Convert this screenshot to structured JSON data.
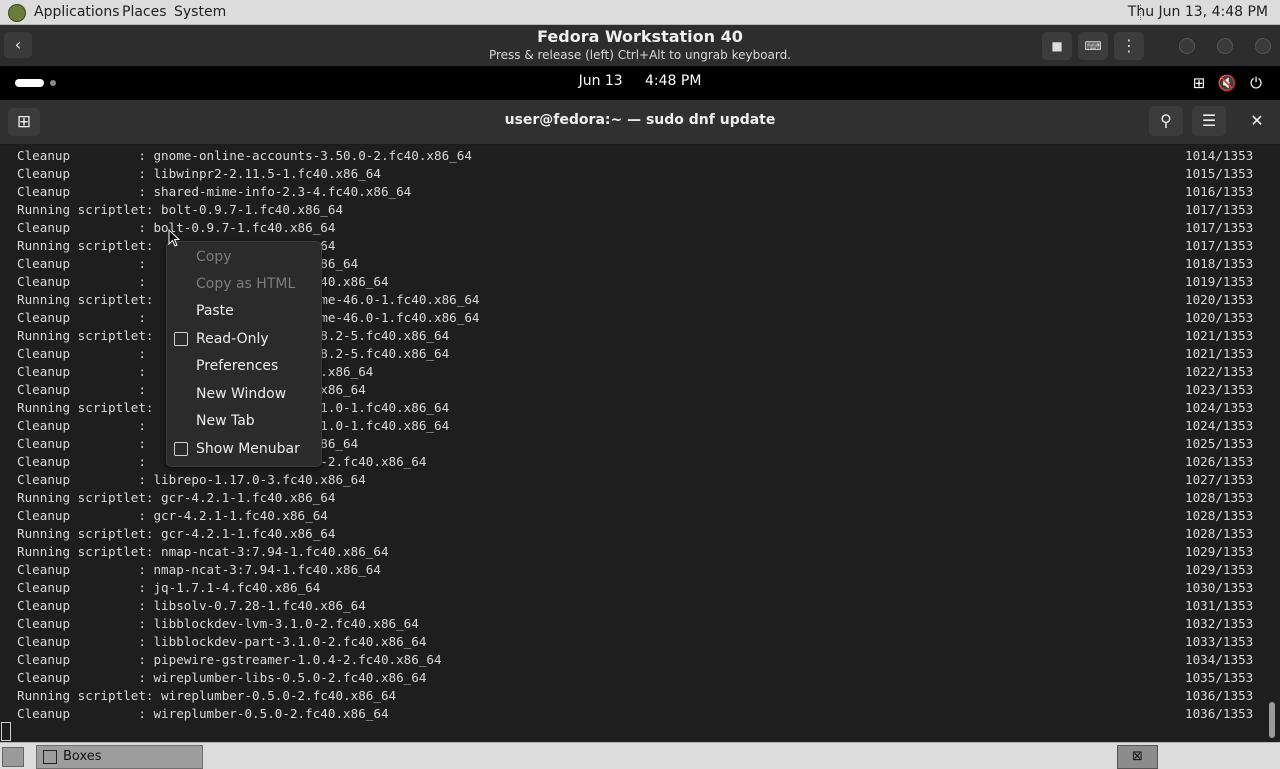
{
  "host_panel": {
    "menus": [
      "Applications",
      "Places",
      "System"
    ],
    "clock": "Thu Jun 13,  4:48 PM"
  },
  "boxes_header": {
    "title": "Fedora Workstation 40",
    "subtitle": "Press & release (left) Ctrl+Alt to ungrab keyboard.",
    "back_icon": "‹",
    "stop_icon": "■",
    "keyboard_icon": "⌨",
    "menu_icon": "⋮"
  },
  "gnome_bar": {
    "date": "Jun 13",
    "time": "4:48 PM",
    "network_icon": "⊞",
    "volume_icon": "🔇",
    "power_icon": "⏻"
  },
  "terminal": {
    "title": "user@fedora:~ — sudo dnf update",
    "new_tab_icon": "⊞",
    "search_icon": "⚲",
    "menu_icon": "☰",
    "close_icon": "✕",
    "lines": [
      {
        "text": "Cleanup         : gnome-online-accounts-3.50.0-2.fc40.x86_64",
        "count": "1014/1353"
      },
      {
        "text": "Cleanup         : libwinpr2-2.11.5-1.fc40.x86_64",
        "count": "1015/1353"
      },
      {
        "text": "Cleanup         : shared-mime-info-2.3-4.fc40.x86_64",
        "count": "1016/1353"
      },
      {
        "text": "Running scriptlet: bolt-0.9.7-1.fc40.x86_64",
        "count": "1017/1353"
      },
      {
        "text": "Cleanup         : bolt-0.9.7-1.fc40.x86_64",
        "count": "1017/1353"
      },
      {
        "text": "Running scriptlet:                   86_64",
        "count": "1017/1353"
      },
      {
        "text": "Cleanup         :                    0.x86_64",
        "count": "1018/1353"
      },
      {
        "text": "Cleanup         :                    .fc40.x86_64",
        "count": "1019/1353"
      },
      {
        "text": "Running scriptlet:                   gnome-46.0-1.fc40.x86_64",
        "count": "1020/1353"
      },
      {
        "text": "Cleanup         :                    gnome-46.0-1.fc40.x86_64",
        "count": "1020/1353"
      },
      {
        "text": "Running scriptlet:                   1.18.2-5.fc40.x86_64",
        "count": "1021/1353"
      },
      {
        "text": "Cleanup         :                    1.18.2-5.fc40.x86_64",
        "count": "1021/1353"
      },
      {
        "text": "Cleanup         :                    c40.x86_64",
        "count": "1022/1353"
      },
      {
        "text": "Cleanup         :                    40.x86_64",
        "count": "1023/1353"
      },
      {
        "text": "Running scriptlet:                   10.1.0-1.fc40.x86_64",
        "count": "1024/1353"
      },
      {
        "text": "Cleanup         :                    10.1.0-1.fc40.x86_64",
        "count": "1024/1353"
      },
      {
        "text": "Cleanup         :                    0.x86_64",
        "count": "1025/1353"
      },
      {
        "text": "Cleanup         :                    1.0-2.fc40.x86_64",
        "count": "1026/1353"
      },
      {
        "text": "Cleanup         : librepo-1.17.0-3.fc40.x86_64",
        "count": "1027/1353"
      },
      {
        "text": "Running scriptlet: gcr-4.2.1-1.fc40.x86_64",
        "count": "1028/1353"
      },
      {
        "text": "Cleanup         : gcr-4.2.1-1.fc40.x86_64",
        "count": "1028/1353"
      },
      {
        "text": "Running scriptlet: gcr-4.2.1-1.fc40.x86_64",
        "count": "1028/1353"
      },
      {
        "text": "Running scriptlet: nmap-ncat-3:7.94-1.fc40.x86_64",
        "count": "1029/1353"
      },
      {
        "text": "Cleanup         : nmap-ncat-3:7.94-1.fc40.x86_64",
        "count": "1029/1353"
      },
      {
        "text": "Cleanup         : jq-1.7.1-4.fc40.x86_64",
        "count": "1030/1353"
      },
      {
        "text": "Cleanup         : libsolv-0.7.28-1.fc40.x86_64",
        "count": "1031/1353"
      },
      {
        "text": "Cleanup         : libblockdev-lvm-3.1.0-2.fc40.x86_64",
        "count": "1032/1353"
      },
      {
        "text": "Cleanup         : libblockdev-part-3.1.0-2.fc40.x86_64",
        "count": "1033/1353"
      },
      {
        "text": "Cleanup         : pipewire-gstreamer-1.0.4-2.fc40.x86_64",
        "count": "1034/1353"
      },
      {
        "text": "Cleanup         : wireplumber-libs-0.5.0-2.fc40.x86_64",
        "count": "1035/1353"
      },
      {
        "text": "Running scriptlet: wireplumber-0.5.0-2.fc40.x86_64",
        "count": "1036/1353"
      },
      {
        "text": "Cleanup         : wireplumber-0.5.0-2.fc40.x86_64",
        "count": "1036/1353"
      }
    ]
  },
  "context_menu": {
    "copy": "Copy",
    "copy_html": "Copy as HTML",
    "paste": "Paste",
    "read_only": "Read-Only",
    "preferences": "Preferences",
    "new_window": "New Window",
    "new_tab": "New Tab",
    "show_menubar": "Show Menubar"
  },
  "taskbar": {
    "task_label": "Boxes"
  }
}
